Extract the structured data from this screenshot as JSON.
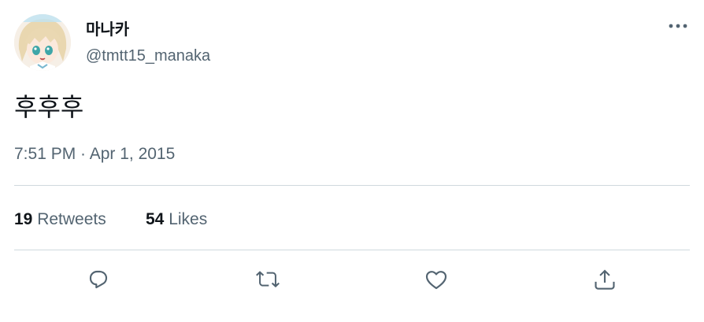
{
  "tweet": {
    "display_name": "마나카",
    "handle": "@tmtt15_manaka",
    "text": "후후후",
    "timestamp": "7:51 PM · Apr 1, 2015"
  },
  "stats": {
    "retweets_count": "19",
    "retweets_label": "Retweets",
    "likes_count": "54",
    "likes_label": "Likes"
  },
  "icons": {
    "more": "more-horizontal-icon",
    "reply": "reply-icon",
    "retweet": "retweet-icon",
    "like": "heart-icon",
    "share": "share-icon"
  },
  "colors": {
    "text_primary": "#0f1419",
    "text_secondary": "#536471",
    "divider": "#cfd9de"
  }
}
